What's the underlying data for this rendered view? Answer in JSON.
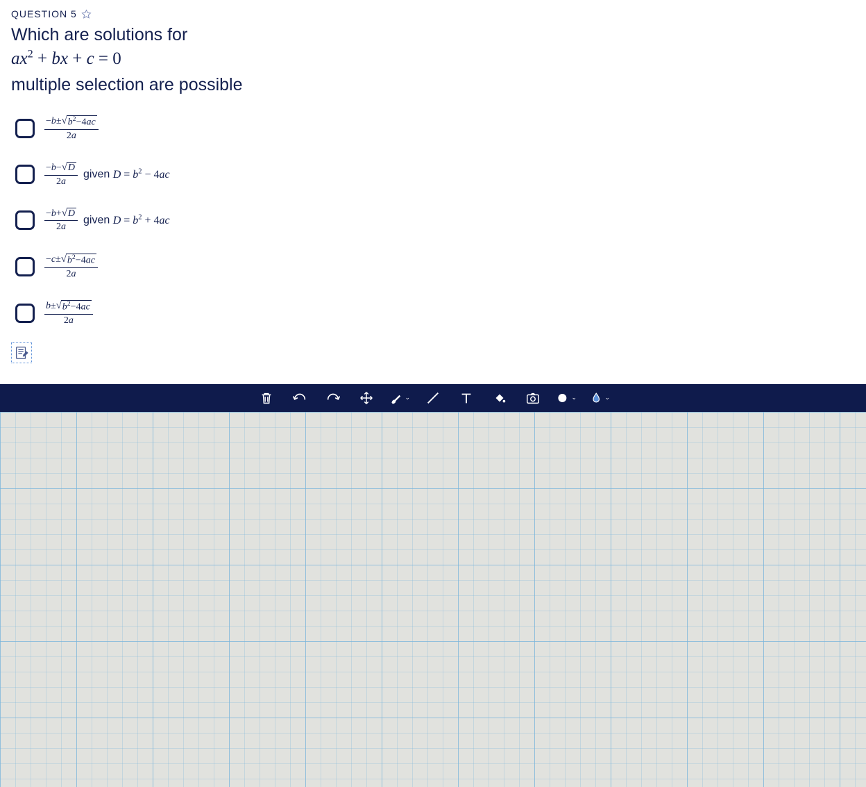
{
  "question": {
    "label": "QUESTION 5",
    "prompt_leadin": "Which are solutions for",
    "subtext": "multiple selection are possible"
  },
  "choices": [
    {
      "id": "a",
      "given_text": ""
    },
    {
      "id": "b",
      "given_text": "given "
    },
    {
      "id": "c",
      "given_text": "given "
    },
    {
      "id": "d",
      "given_text": ""
    },
    {
      "id": "e",
      "given_text": ""
    }
  ],
  "toolbar": {
    "items": [
      "trash",
      "undo",
      "redo",
      "move",
      "brush",
      "line",
      "text",
      "fill",
      "camera",
      "solid-color",
      "highlighter"
    ]
  }
}
